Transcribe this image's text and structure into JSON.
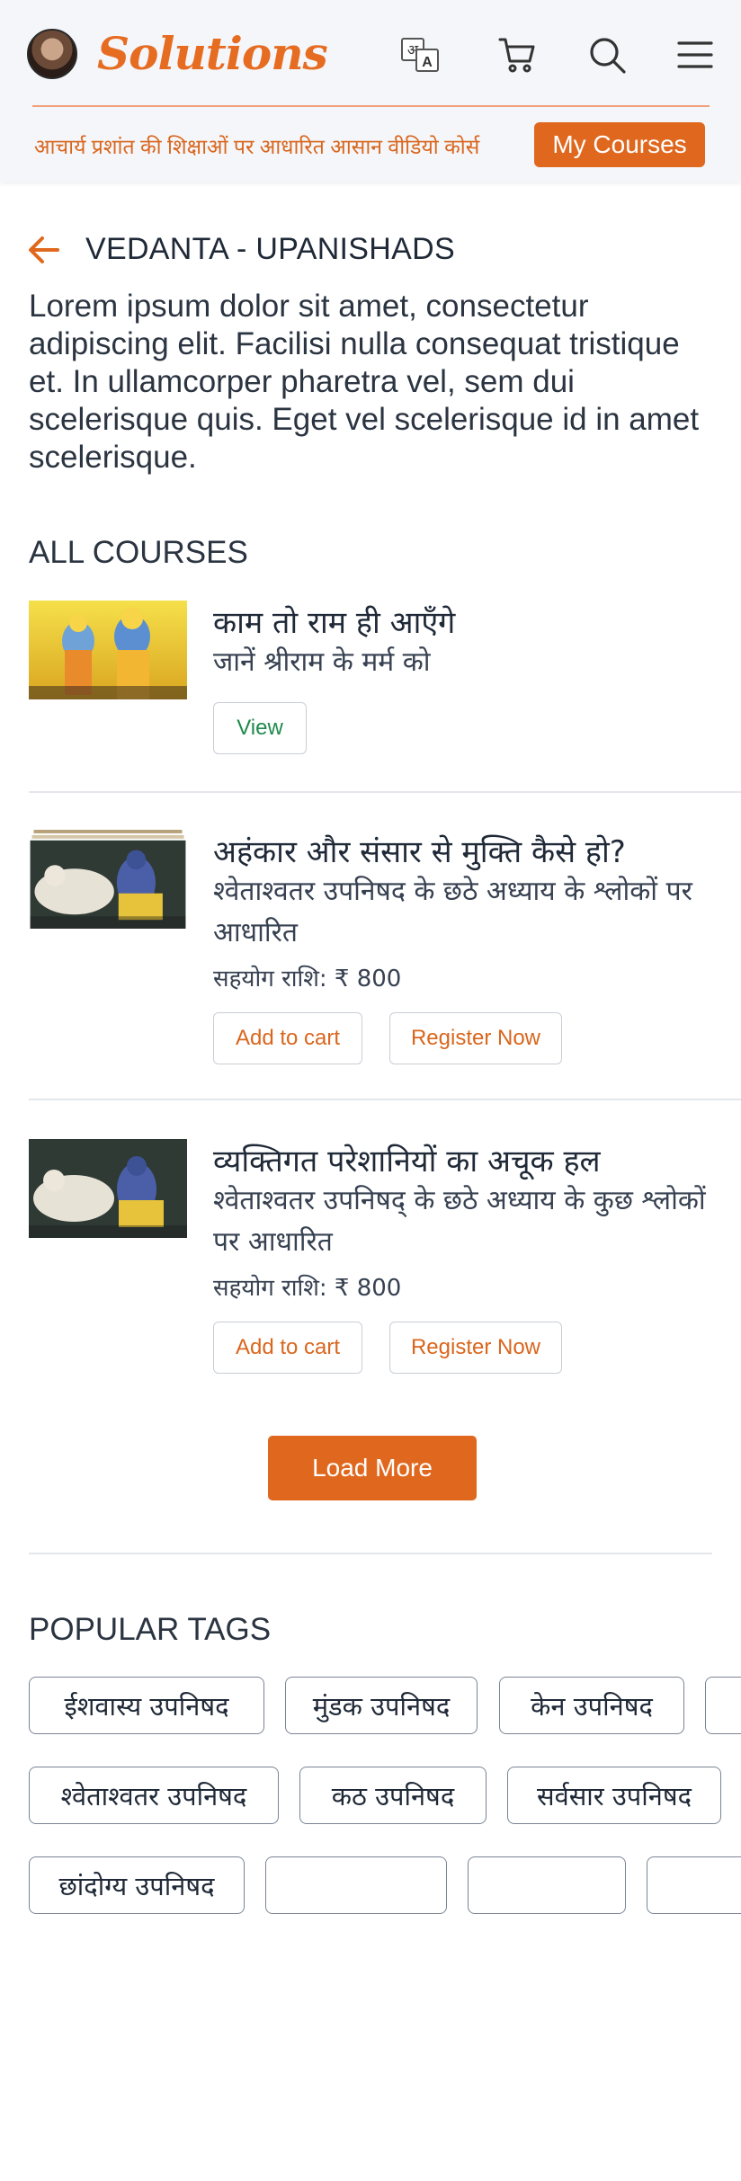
{
  "header": {
    "brand": "Solutions",
    "tagline": "आचार्य प्रशांत की शिक्षाओं पर आधारित आसान वीडियो कोर्स",
    "my_courses_label": "My Courses",
    "icons": [
      "translate-icon",
      "cart-icon",
      "search-icon",
      "menu-icon"
    ]
  },
  "page": {
    "title": "VEDANTA - UPANISHADS",
    "description": "Lorem ipsum dolor sit amet, consectetur adipiscing elit. Facilisi nulla consequat tristique et. In ullamcorper pharetra vel, sem dui scelerisque quis. Eget vel scelerisque id in amet scelerisque."
  },
  "courses_section": {
    "title": "ALL COURSES",
    "items": [
      {
        "title": "काम तो राम ही आएँगे",
        "subtitle": "जानें श्रीराम के मर्म को",
        "view_label": "View"
      },
      {
        "title": "अहंकार और संसार से मुक्ति कैसे हो?",
        "subtitle": "श्वेताश्वतर उपनिषद के छठे अध्याय के श्लोकों पर आधारित",
        "price": "सहयोग राशि: ₹ 800",
        "add_label": "Add to cart",
        "register_label": "Register Now"
      },
      {
        "title": "व्यक्तिगत परेशानियों का अचूक हल",
        "subtitle": "श्वेताश्वतर उपनिषद् के छठे अध्याय के कुछ श्लोकों पर आधारित",
        "price": "सहयोग राशि: ₹ 800",
        "add_label": "Add to cart",
        "register_label": "Register Now"
      }
    ],
    "load_more_label": "Load More"
  },
  "tags_section": {
    "title": "POPULAR TAGS",
    "tags": [
      "ईशवास्य उपनिषद",
      "मुंडक उपनिषद",
      "केन उपनिषद",
      "",
      "श्वेताश्वतर उपनिषद",
      "कठ उपनिषद",
      "सर्वसार उपनिषद",
      "छांदोग्य उपनिषद",
      "",
      "",
      ""
    ]
  },
  "colors": {
    "accent": "#e0681e",
    "header_bg": "#f4f6f9",
    "view_text": "#1f8a4c",
    "text": "#1f2937"
  }
}
